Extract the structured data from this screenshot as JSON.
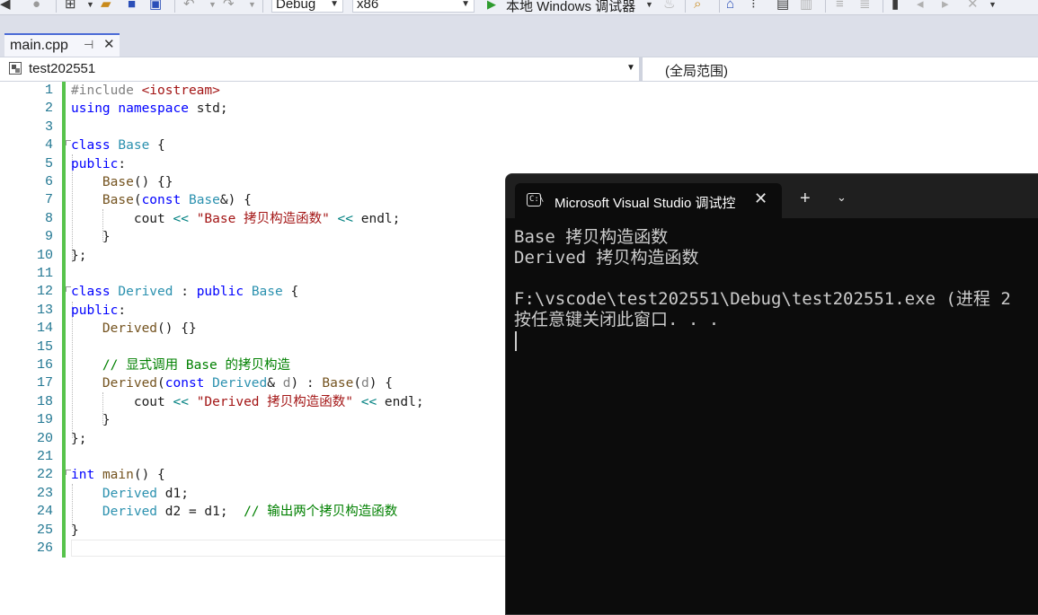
{
  "toolbar": {
    "config_label": "Debug",
    "platform_label": "x86",
    "run_label": "本地 Windows 调试器"
  },
  "tab": {
    "label": "main.cpp"
  },
  "nav": {
    "project": "test202551",
    "scope": "(全局范围)"
  },
  "editor": {
    "line_numbers": [
      "1",
      "2",
      "3",
      "4",
      "5",
      "6",
      "7",
      "8",
      "9",
      "10",
      "11",
      "12",
      "13",
      "14",
      "15",
      "16",
      "17",
      "18",
      "19",
      "20",
      "21",
      "22",
      "23",
      "24",
      "25",
      "26"
    ],
    "lines": [
      [
        {
          "t": "#include ",
          "c": "pp"
        },
        {
          "t": "<iostream>",
          "c": "inc"
        }
      ],
      [
        {
          "t": "using",
          "c": "kw"
        },
        {
          "t": " "
        },
        {
          "t": "namespace",
          "c": "kw"
        },
        {
          "t": " std;"
        }
      ],
      [],
      [
        {
          "t": "class",
          "c": "kw"
        },
        {
          "t": " "
        },
        {
          "t": "Base",
          "c": "ty"
        },
        {
          "t": " {"
        }
      ],
      [
        {
          "t": "public",
          "c": "kw"
        },
        {
          "t": ":"
        }
      ],
      [
        {
          "t": "    "
        },
        {
          "t": "Base",
          "c": "fn"
        },
        {
          "t": "() {}"
        }
      ],
      [
        {
          "t": "    "
        },
        {
          "t": "Base",
          "c": "fn"
        },
        {
          "t": "("
        },
        {
          "t": "const",
          "c": "kw"
        },
        {
          "t": " "
        },
        {
          "t": "Base",
          "c": "ty"
        },
        {
          "t": "&) {"
        }
      ],
      [
        {
          "t": "        cout "
        },
        {
          "t": "<<",
          "c": "op"
        },
        {
          "t": " "
        },
        {
          "t": "\"Base 拷贝构造函数\"",
          "c": "str"
        },
        {
          "t": " "
        },
        {
          "t": "<<",
          "c": "op"
        },
        {
          "t": " endl;"
        }
      ],
      [
        {
          "t": "    }"
        }
      ],
      [
        {
          "t": "};"
        }
      ],
      [],
      [
        {
          "t": "class",
          "c": "kw"
        },
        {
          "t": " "
        },
        {
          "t": "Derived",
          "c": "ty"
        },
        {
          "t": " : "
        },
        {
          "t": "public",
          "c": "kw"
        },
        {
          "t": " "
        },
        {
          "t": "Base",
          "c": "ty"
        },
        {
          "t": " {"
        }
      ],
      [
        {
          "t": "public",
          "c": "kw"
        },
        {
          "t": ":"
        }
      ],
      [
        {
          "t": "    "
        },
        {
          "t": "Derived",
          "c": "fn"
        },
        {
          "t": "() {}"
        }
      ],
      [],
      [
        {
          "t": "    "
        },
        {
          "t": "// 显式调用 Base 的拷贝构造",
          "c": "cm"
        }
      ],
      [
        {
          "t": "    "
        },
        {
          "t": "Derived",
          "c": "fn"
        },
        {
          "t": "("
        },
        {
          "t": "const",
          "c": "kw"
        },
        {
          "t": " "
        },
        {
          "t": "Derived",
          "c": "ty"
        },
        {
          "t": "& "
        },
        {
          "t": "d",
          "c": "prm"
        },
        {
          "t": ") : "
        },
        {
          "t": "Base",
          "c": "fn"
        },
        {
          "t": "("
        },
        {
          "t": "d",
          "c": "prm"
        },
        {
          "t": ") {"
        }
      ],
      [
        {
          "t": "        cout "
        },
        {
          "t": "<<",
          "c": "op"
        },
        {
          "t": " "
        },
        {
          "t": "\"Derived 拷贝构造函数\"",
          "c": "str"
        },
        {
          "t": " "
        },
        {
          "t": "<<",
          "c": "op"
        },
        {
          "t": " endl;"
        }
      ],
      [
        {
          "t": "    }"
        }
      ],
      [
        {
          "t": "};"
        }
      ],
      [],
      [
        {
          "t": "int",
          "c": "kw"
        },
        {
          "t": " "
        },
        {
          "t": "main",
          "c": "fn"
        },
        {
          "t": "() {"
        }
      ],
      [
        {
          "t": "    "
        },
        {
          "t": "Derived",
          "c": "ty"
        },
        {
          "t": " d1;"
        }
      ],
      [
        {
          "t": "    "
        },
        {
          "t": "Derived",
          "c": "ty"
        },
        {
          "t": " d2 = d1;  "
        },
        {
          "t": "// 输出两个拷贝构造函数",
          "c": "cm"
        }
      ],
      [
        {
          "t": "}"
        }
      ],
      []
    ]
  },
  "console": {
    "title": "Microsoft Visual Studio 调试控",
    "icon_text": "C:\\",
    "output_lines": [
      "Base 拷贝构造函数",
      "Derived 拷贝构造函数",
      "",
      "F:\\vscode\\test202551\\Debug\\test202551.exe (进程 2",
      "按任意键关闭此窗口. . ."
    ]
  },
  "colors": {
    "accent": "#4b6bd6",
    "change_bar": "#57c34c",
    "console_bg": "#0c0c0c",
    "console_text": "#cccccc"
  }
}
